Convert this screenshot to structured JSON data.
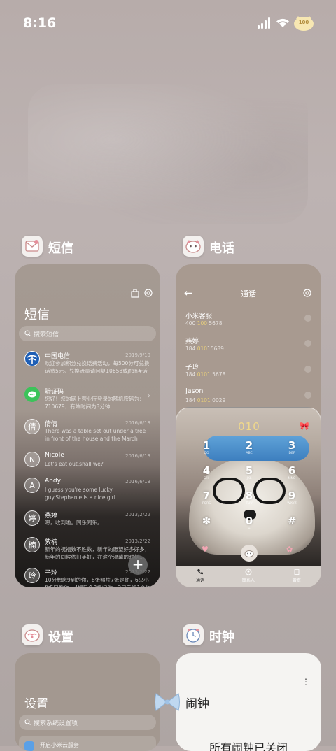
{
  "status_bar": {
    "time": "8:16",
    "battery": "100"
  },
  "apps": [
    {
      "name": "短信"
    },
    {
      "name": "电话"
    },
    {
      "name": "设置"
    },
    {
      "name": "时钟"
    }
  ],
  "sms": {
    "title": "短信",
    "search_placeholder": "搜索短信",
    "threads": [
      {
        "name": "中国电信",
        "date": "2019/9/10",
        "preview": "欢迎参加积分兑换话费活动，每500分可兑换话费5元。兑换流量请回复10658或jfdh#话费"
      },
      {
        "name": "验证码",
        "date": "",
        "preview": "您好！您的网上营业厅登录的随机密码为：710679，有效时间为3分钟"
      },
      {
        "name": "倩倩",
        "avatar": "倩",
        "date": "2016/6/13",
        "preview": "There was a table set out under a tree in front of the house,and the March Hare and..."
      },
      {
        "name": "Nicole",
        "avatar": "N",
        "date": "2016/6/13",
        "preview": "Let's eat out,shall we?"
      },
      {
        "name": "Andy",
        "avatar": "A",
        "date": "2016/6/13",
        "preview": "I guess you're some lucky guy.Stephanie is a nice girl."
      },
      {
        "name": "燕婷",
        "avatar": "婷",
        "date": "2013/2/22",
        "preview": "嗯，收到啦。同乐同乐。"
      },
      {
        "name": "紫楠",
        "avatar": "楠",
        "date": "2013/2/22",
        "preview": "新年的祝福数不胜数，新年的愿望好多好多，新年的同候依旧美好，在这个温馨的时刻..."
      },
      {
        "name": "子玲",
        "avatar": "玲",
        "date": "2013/2/22",
        "preview": "10分想念9到的你，8张照片7张是你，6只小狗5只像你，4根另多3根归你，2只手给1个你"
      }
    ],
    "fab": "+"
  },
  "phone": {
    "back": "←",
    "title": "通话",
    "recents": [
      {
        "name": "小米客服",
        "num_a": "400 ",
        "num_hl": "100",
        "num_b": " 5678"
      },
      {
        "name": "燕婷",
        "num_a": "184 ",
        "num_hl": "010",
        "num_b": "15689"
      },
      {
        "name": "子玲",
        "num_a": "184 ",
        "num_hl": "0101",
        "num_b": " 5678"
      },
      {
        "name": "Jason",
        "num_a": "184 ",
        "num_hl": "0101",
        "num_b": " 0029"
      }
    ],
    "dial_input": "010",
    "keys": [
      {
        "d": "1",
        "l": "QO"
      },
      {
        "d": "2",
        "l": "ABC"
      },
      {
        "d": "3",
        "l": "DEF"
      },
      {
        "d": "4",
        "l": "GHI"
      },
      {
        "d": "5",
        "l": "JKL"
      },
      {
        "d": "6",
        "l": "MNO"
      },
      {
        "d": "7",
        "l": "PQRS"
      },
      {
        "d": "8",
        "l": "TUV"
      },
      {
        "d": "9",
        "l": "WXYZ"
      },
      {
        "d": "✽",
        "l": ""
      },
      {
        "d": "0",
        "l": "+"
      },
      {
        "d": "#",
        "l": ""
      }
    ],
    "tabs": [
      "通话",
      "联系人",
      "黄页"
    ]
  },
  "settings": {
    "title": "设置",
    "search_placeholder": "搜索系统设置项",
    "first_item": "开启小米云服务"
  },
  "clock": {
    "title": "闹钟",
    "more": "⋮",
    "status": "所有闹钟已关闭"
  },
  "colors": {
    "accent_gold": "#e8cf7a",
    "card_tan": "#a89a90"
  }
}
